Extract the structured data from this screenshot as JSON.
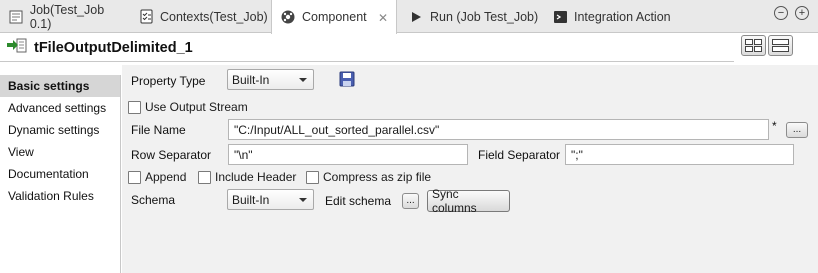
{
  "tabs": [
    {
      "label": "Job(Test_Job 0.1)",
      "icon": "job-icon"
    },
    {
      "label": "Contexts(Test_Job)",
      "icon": "contexts-icon"
    },
    {
      "label": "Component",
      "icon": "component-icon",
      "active": true
    },
    {
      "label": "Run (Job Test_Job)",
      "icon": "run-icon"
    },
    {
      "label": "Integration Action",
      "icon": "integration-icon"
    }
  ],
  "window_controls": {
    "minimize": "−",
    "maximize": "+"
  },
  "component": {
    "title": "tFileOutputDelimited_1"
  },
  "sidebar": {
    "items": [
      {
        "label": "Basic settings"
      },
      {
        "label": "Advanced settings"
      },
      {
        "label": "Dynamic settings"
      },
      {
        "label": "View"
      },
      {
        "label": "Documentation"
      },
      {
        "label": "Validation Rules"
      }
    ]
  },
  "form": {
    "property_type_label": "Property Type",
    "property_type_value": "Built-In",
    "use_output_stream_label": "Use Output Stream",
    "file_name_label": "File Name",
    "file_name_value": "\"C:/Input/ALL_out_sorted_parallel.csv\"",
    "file_name_marker": "*",
    "browse_label": "...",
    "row_separator_label": "Row Separator",
    "row_separator_value": "\"\\n\"",
    "field_separator_label": "Field Separator",
    "field_separator_value": "\";\"",
    "append_label": "Append",
    "include_header_label": "Include Header",
    "compress_label": "Compress as zip file",
    "schema_label": "Schema",
    "schema_value": "Built-In",
    "edit_schema_label": "Edit schema",
    "edit_schema_button": "...",
    "sync_columns_label": "Sync columns"
  },
  "colors": {
    "accent": "#2d8a2d",
    "main_bg": "#f1f1f1",
    "active_nav": "#d6d6d6"
  }
}
